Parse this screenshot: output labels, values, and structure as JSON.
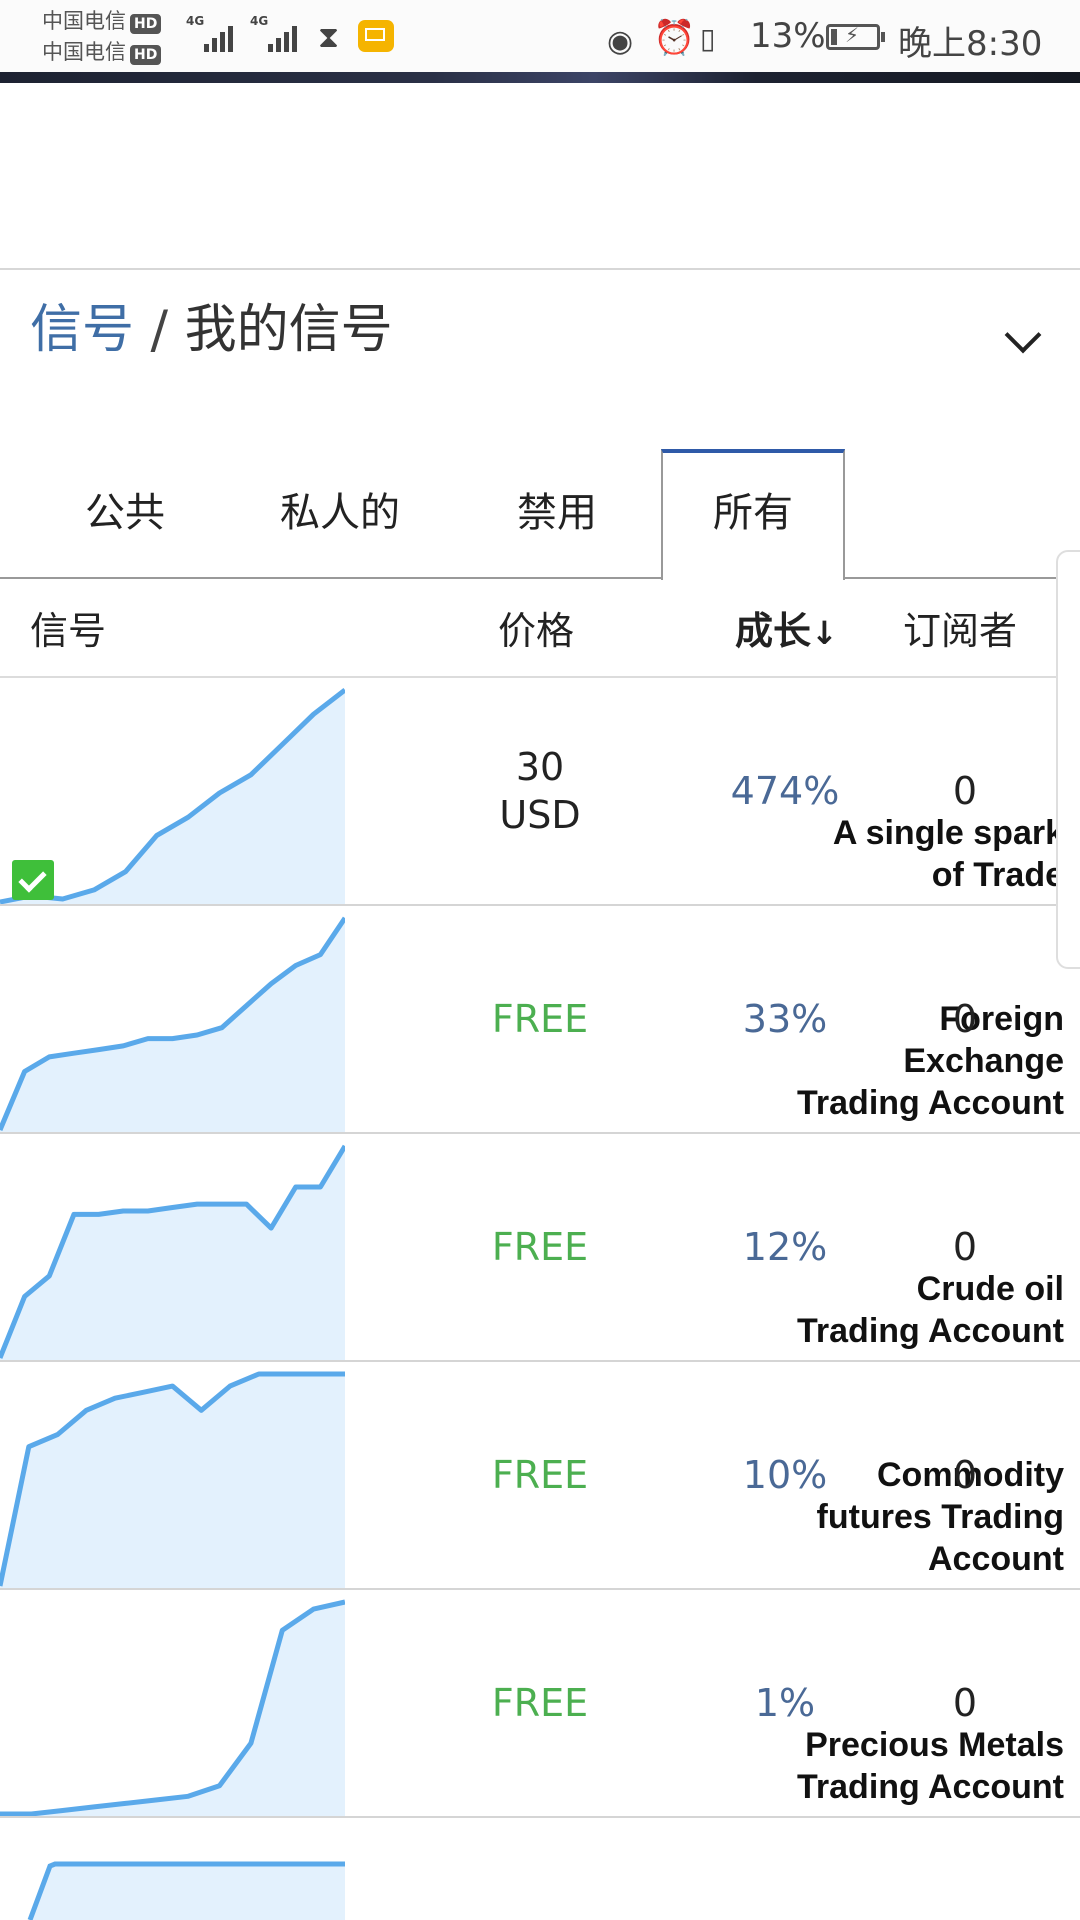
{
  "status_bar": {
    "carrier_1": "中国电信",
    "carrier_2": "中国电信",
    "hd_badge": "HD",
    "network_1": "4G",
    "network_2": "4G",
    "battery_percent": "13%",
    "time": "晚上8:30",
    "icons": [
      "signal-icon",
      "hourglass-icon",
      "mail-icon",
      "eye-icon",
      "alarm-icon",
      "vibrate-icon",
      "battery-charging-icon"
    ]
  },
  "breadcrumb": {
    "root": "信号",
    "separator": "/",
    "current": "我的信号"
  },
  "tabs": [
    {
      "label": "公共",
      "active": false
    },
    {
      "label": "私人的",
      "active": false
    },
    {
      "label": "禁用",
      "active": false
    },
    {
      "label": "所有",
      "active": true
    }
  ],
  "table": {
    "headers": {
      "signal": "信号",
      "price": "价格",
      "growth": "成长",
      "growth_sort": "↓",
      "subscribers": "订阅者"
    },
    "rows": [
      {
        "name_lines": [
          "A single spark",
          "of Trade"
        ],
        "price_lines": [
          "30",
          "USD"
        ],
        "price_type": "paid",
        "growth": "474%",
        "subscribers": "0",
        "verified": true,
        "sparkline": [
          10,
          12,
          11,
          14,
          20,
          32,
          38,
          46,
          52,
          62,
          72,
          80
        ]
      },
      {
        "name_lines": [
          "Foreign",
          "Exchange",
          "Trading Account"
        ],
        "price_lines": [
          "FREE"
        ],
        "price_type": "free",
        "growth": "33%",
        "subscribers": "0",
        "verified": false,
        "sparkline": [
          0,
          16,
          20,
          21,
          22,
          23,
          25,
          25,
          26,
          28,
          34,
          40,
          45,
          48,
          58
        ]
      },
      {
        "name_lines": [
          "Crude oil",
          "Trading Account"
        ],
        "price_lines": [
          "FREE"
        ],
        "price_type": "free",
        "growth": "12%",
        "subscribers": "0",
        "verified": false,
        "sparkline": [
          0,
          18,
          24,
          42,
          42,
          43,
          43,
          44,
          45,
          45,
          45,
          38,
          50,
          50,
          62
        ]
      },
      {
        "name_lines": [
          "Commodity",
          "futures Trading",
          "Account"
        ],
        "price_lines": [
          "FREE"
        ],
        "price_type": "free",
        "growth": "10%",
        "subscribers": "0",
        "verified": false,
        "sparkline": [
          0,
          46,
          50,
          58,
          62,
          64,
          66,
          58,
          66,
          70,
          70,
          70,
          70
        ]
      },
      {
        "name_lines": [
          "Precious Metals",
          "Trading Account"
        ],
        "price_lines": [
          "FREE"
        ],
        "price_type": "free",
        "growth": "1%",
        "subscribers": "0",
        "verified": false,
        "sparkline": [
          0,
          0,
          1,
          2,
          3,
          4,
          5,
          8,
          20,
          52,
          58,
          60
        ]
      }
    ]
  },
  "colors": {
    "link_blue": "#3f6ea6",
    "growth_blue": "#4a6996",
    "free_green": "#4caf50",
    "tab_accent": "#2f5aa8",
    "sparkline_line": "#5aa9ea",
    "sparkline_fill": "#e3f1fd"
  }
}
